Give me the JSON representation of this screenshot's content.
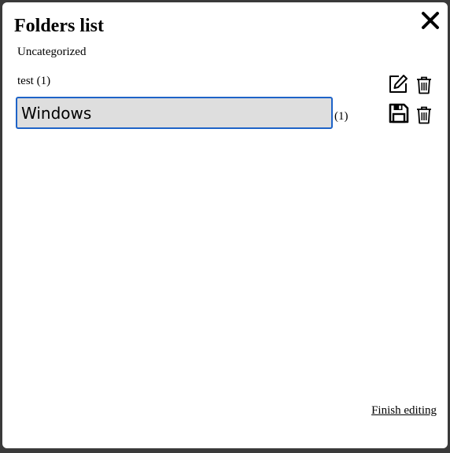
{
  "dialog": {
    "title": "Folders list",
    "finish_label": "Finish editing"
  },
  "folders": {
    "uncategorized_label": "Uncategorized",
    "items": [
      {
        "name": "test",
        "count": "(1)",
        "display": "test (1)"
      },
      {
        "name": "Windows",
        "count": "(1)",
        "editing": true
      }
    ]
  },
  "icons": {
    "close": "close-icon",
    "edit": "edit-icon",
    "save": "save-icon",
    "delete": "trash-icon"
  }
}
